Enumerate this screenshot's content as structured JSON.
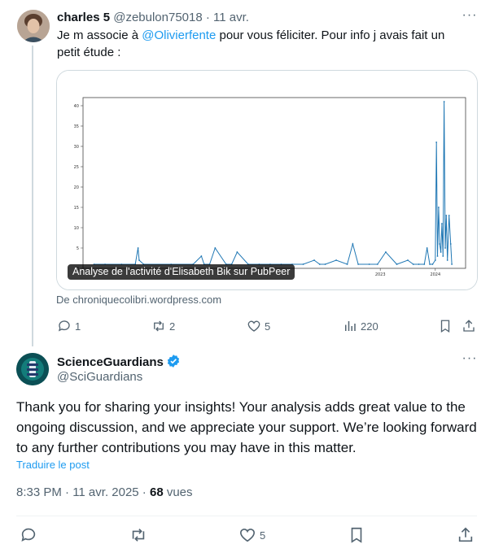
{
  "reply": {
    "display_name": "charles 5",
    "handle": "@zebulon75018",
    "separator": "·",
    "date": "11 avr.",
    "text_before": "Je m associe à ",
    "mention": "@Olivierfente",
    "text_after": " pour vous féliciter. Pour info j avais fait un petit étude :",
    "card": {
      "label": "Analyse de l'activité d'Elisabeth Bik sur PubPeer",
      "source": "De chroniquecolibri.wordpress.com"
    },
    "stats": {
      "replies": "1",
      "reposts": "2",
      "likes": "5",
      "views": "220"
    }
  },
  "main": {
    "display_name": "ScienceGuardians",
    "handle": "@SciGuardians",
    "text": "Thank you for sharing your insights! Your analysis adds great value to the ongoing discussion, and we appreciate your support. We’re looking forward to any further contributions you may have in this matter.",
    "translate": "Traduire le post",
    "time": "8:33 PM · 11 avr. 2025 · ",
    "views_count": "68",
    "views_label": " vues",
    "likes": "5"
  },
  "chart_data": {
    "type": "line",
    "x_ticks": [
      "2023",
      "2024"
    ],
    "y_ticks": [
      "0",
      "5",
      "10",
      "15",
      "20",
      "25",
      "30",
      "35",
      "40"
    ],
    "ylim": [
      0,
      42
    ],
    "x": [
      2017.8,
      2018.0,
      2018.3,
      2018.55,
      2018.6,
      2018.62,
      2018.7,
      2019.2,
      2019.6,
      2019.75,
      2019.8,
      2019.9,
      2020.0,
      2020.2,
      2020.3,
      2020.4,
      2020.6,
      2020.8,
      2021.0,
      2021.2,
      2021.4,
      2021.6,
      2021.8,
      2021.9,
      2022.0,
      2022.2,
      2022.4,
      2022.5,
      2022.6,
      2022.8,
      2022.95,
      2023.1,
      2023.3,
      2023.5,
      2023.6,
      2023.7,
      2023.8,
      2023.85,
      2023.9,
      2023.95,
      2024.0,
      2024.02,
      2024.04,
      2024.06,
      2024.08,
      2024.1,
      2024.12,
      2024.14,
      2024.16,
      2024.18,
      2024.2,
      2024.22,
      2024.25,
      2024.28,
      2024.3
    ],
    "y": [
      1,
      1,
      1,
      1,
      5,
      2,
      1,
      1,
      1,
      3,
      1,
      1,
      5,
      1,
      1,
      4,
      1,
      1,
      1,
      1,
      1,
      1,
      2,
      1,
      1,
      2,
      1,
      6,
      1,
      1,
      1,
      4,
      1,
      2,
      1,
      1,
      1,
      5,
      1,
      1,
      2,
      31,
      3,
      15,
      6,
      4,
      11,
      3,
      41,
      5,
      13,
      2,
      13,
      6,
      1
    ]
  }
}
